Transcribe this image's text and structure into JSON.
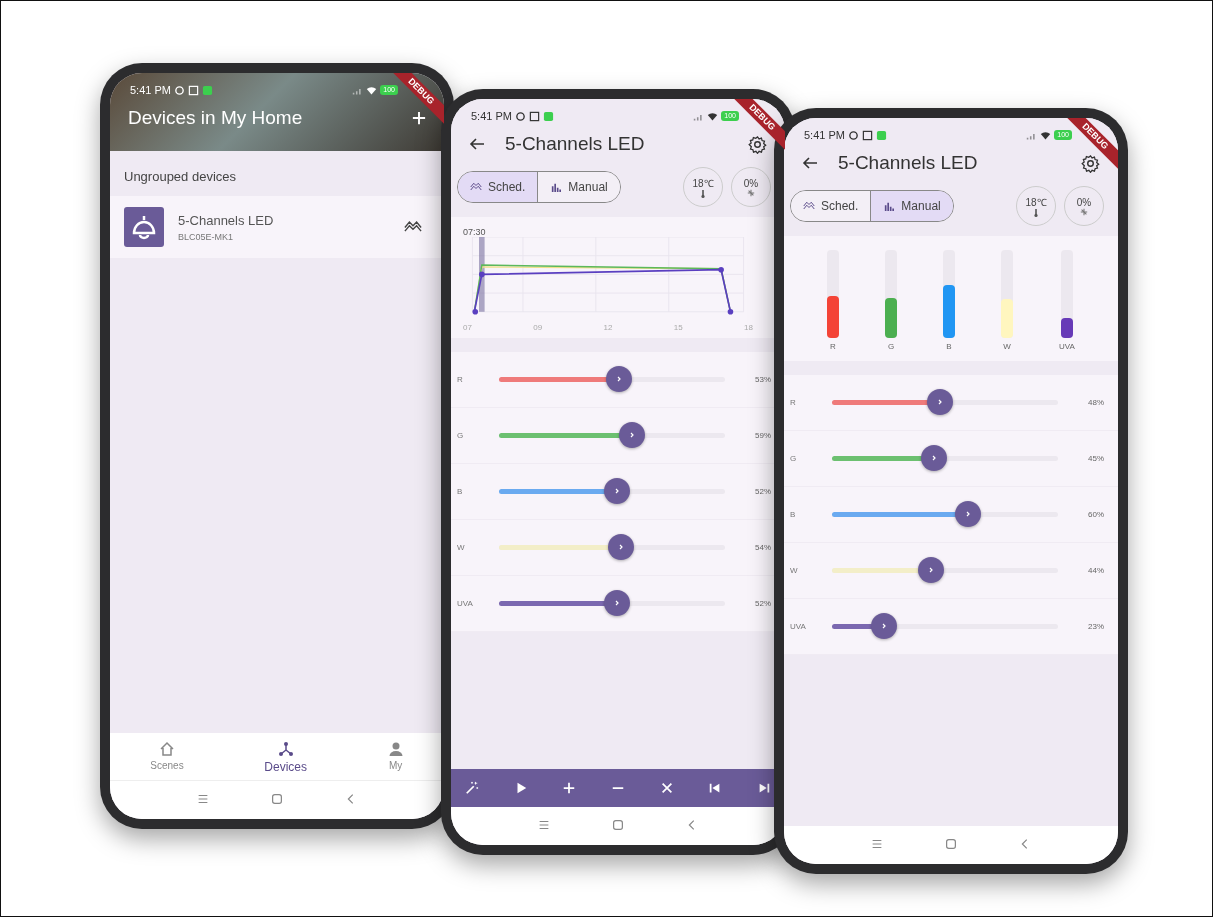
{
  "phones": [
    {
      "kind": "home",
      "status": {
        "time": "5:41 PM",
        "battery": "100"
      },
      "debug_banner": "DEBUG",
      "title": "Devices in My Home",
      "section": "Ungrouped devices",
      "devices": [
        {
          "name": "5-Channels LED",
          "model": "BLC05E-MK1"
        }
      ],
      "nav": [
        {
          "label": "Scenes",
          "selected": false
        },
        {
          "label": "Devices",
          "selected": true
        },
        {
          "label": "My",
          "selected": false
        }
      ]
    },
    {
      "kind": "schedule",
      "status": {
        "time": "5:41 PM",
        "battery": "100"
      },
      "debug_banner": "DEBUG",
      "title": "5-Channels LED",
      "modes": [
        {
          "label": "Sched.",
          "selected": true
        },
        {
          "label": "Manual",
          "selected": false
        }
      ],
      "temperature": "18℃",
      "fan": "0%",
      "chart": {
        "cursor_label": "07:30",
        "x_labels": [
          "07",
          "09",
          "12",
          "15",
          "18"
        ]
      },
      "channels": [
        {
          "name": "R",
          "level": 0.53,
          "reading": "53%",
          "color": "#ef7a7a"
        },
        {
          "name": "G",
          "level": 0.59,
          "reading": "59%",
          "color": "#6cc070"
        },
        {
          "name": "B",
          "level": 0.52,
          "reading": "52%",
          "color": "#6aaaf0"
        },
        {
          "name": "W",
          "level": 0.54,
          "reading": "54%",
          "color": "#f3eec8"
        },
        {
          "name": "UVA",
          "level": 0.52,
          "reading": "52%",
          "color": "#7b68b0"
        }
      ]
    },
    {
      "kind": "manual",
      "status": {
        "time": "5:41 PM",
        "battery": "100"
      },
      "debug_banner": "DEBUG",
      "title": "5-Channels LED",
      "modes": [
        {
          "label": "Sched.",
          "selected": false
        },
        {
          "label": "Manual",
          "selected": true
        }
      ],
      "temperature": "18℃",
      "fan": "0%",
      "bars": [
        {
          "name": "R",
          "level": 0.48,
          "color": "#f44336"
        },
        {
          "name": "G",
          "level": 0.45,
          "color": "#4caf50"
        },
        {
          "name": "B",
          "level": 0.6,
          "color": "#2196f3"
        },
        {
          "name": "W",
          "level": 0.44,
          "color": "#fff6bf"
        },
        {
          "name": "UVA",
          "level": 0.23,
          "color": "#673ab7"
        }
      ],
      "channels": [
        {
          "name": "R",
          "level": 0.48,
          "reading": "48%",
          "color": "#ef7a7a"
        },
        {
          "name": "G",
          "level": 0.45,
          "reading": "45%",
          "color": "#6cc070"
        },
        {
          "name": "B",
          "level": 0.6,
          "reading": "60%",
          "color": "#6aaaf0"
        },
        {
          "name": "W",
          "level": 0.44,
          "reading": "44%",
          "color": "#f3eec8"
        },
        {
          "name": "UVA",
          "level": 0.23,
          "reading": "23%",
          "color": "#7b68b0"
        }
      ]
    }
  ]
}
